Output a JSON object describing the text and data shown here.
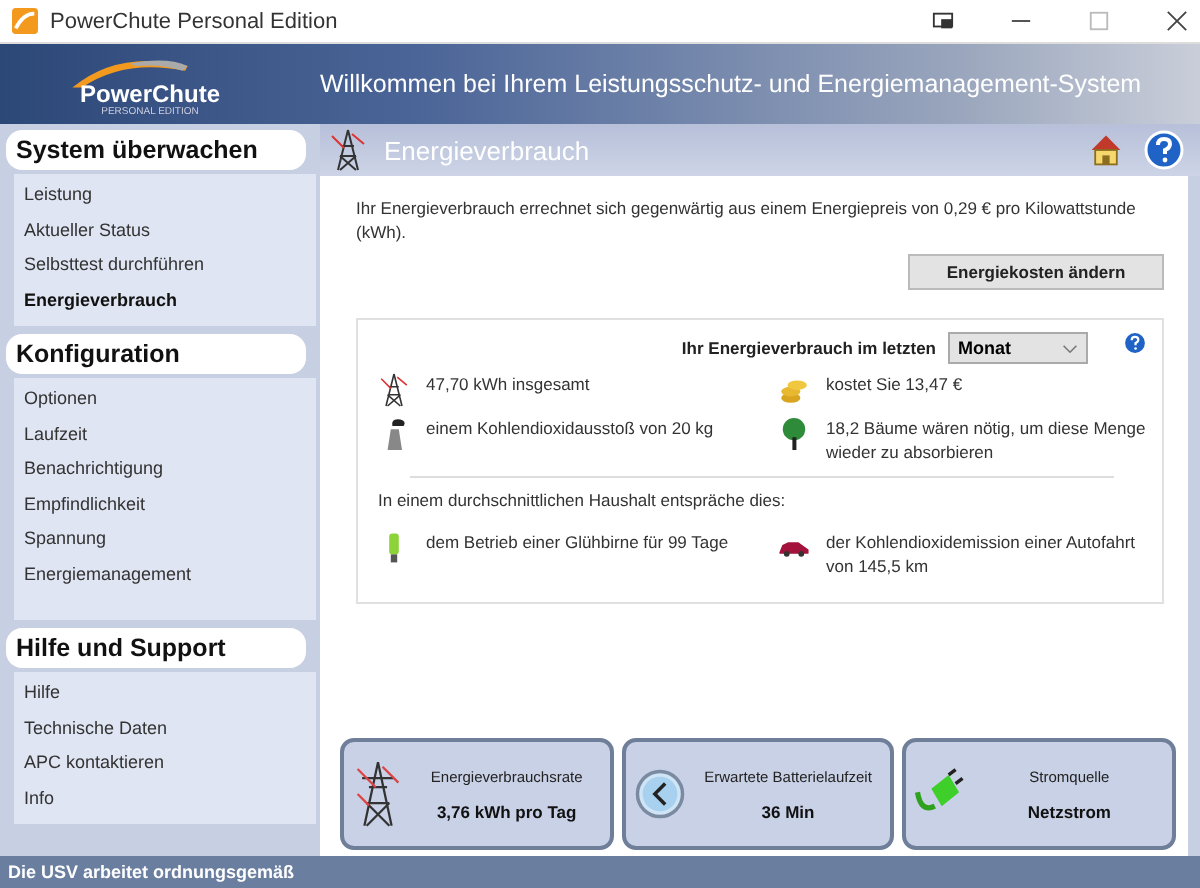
{
  "window": {
    "title": "PowerChute Personal Edition"
  },
  "logo": {
    "name": "PowerChute",
    "subtitle": "PERSONAL EDITION"
  },
  "header": {
    "title": "Willkommen bei Ihrem Leistungsschutz- und Energiemanagement-System"
  },
  "page": {
    "title": "Energieverbrauch"
  },
  "sidebar": {
    "sections": [
      {
        "title": "System überwachen",
        "items": [
          {
            "label": "Leistung",
            "selected": false
          },
          {
            "label": "Aktueller Status",
            "selected": false
          },
          {
            "label": "Selbsttest durchführen",
            "selected": false
          },
          {
            "label": "Energieverbrauch",
            "selected": true
          }
        ]
      },
      {
        "title": "Konfiguration",
        "items": [
          {
            "label": "Optionen",
            "selected": false
          },
          {
            "label": "Laufzeit",
            "selected": false
          },
          {
            "label": "Benachrichtigung",
            "selected": false
          },
          {
            "label": "Empfindlichkeit",
            "selected": false
          },
          {
            "label": "Spannung",
            "selected": false
          },
          {
            "label": "Energiemanagement",
            "selected": false
          }
        ]
      },
      {
        "title": "Hilfe und Support",
        "items": [
          {
            "label": "Hilfe",
            "selected": false
          },
          {
            "label": "Technische Daten",
            "selected": false
          },
          {
            "label": "APC kontaktieren",
            "selected": false
          },
          {
            "label": "Info",
            "selected": false
          }
        ]
      }
    ]
  },
  "intro": "Ihr Energieverbrauch errechnet sich gegenwärtig aus einem Energiepreis von 0,29 € pro Kilowattstunde (kWh).",
  "change_button": "Energiekosten ändern",
  "panel": {
    "period_label": "Ihr Energieverbrauch im letzten",
    "period": "Monat",
    "stats": [
      "47,70 kWh insgesamt",
      "kostet Sie  13,47 €",
      "einem Kohlendioxidausstoß von 20 kg",
      "18,2 Bäume wären nötig, um diese Menge wieder zu absorbieren"
    ],
    "household_intro": "In einem durchschnittlichen Haushalt entspräche dies:",
    "household": [
      "dem Betrieb einer Glühbirne für 99 Tage",
      "der Kohlendioxidemission einer Autofahrt von 145,5 km"
    ]
  },
  "cards": [
    {
      "label": "Energieverbrauchsrate",
      "value": "3,76 kWh pro Tag"
    },
    {
      "label": "Erwartete Batterielaufzeit",
      "value": "36 Min"
    },
    {
      "label": "Stromquelle",
      "value": "Netzstrom"
    }
  ],
  "status_bar": "Die USV arbeitet ordnungsgemäß"
}
